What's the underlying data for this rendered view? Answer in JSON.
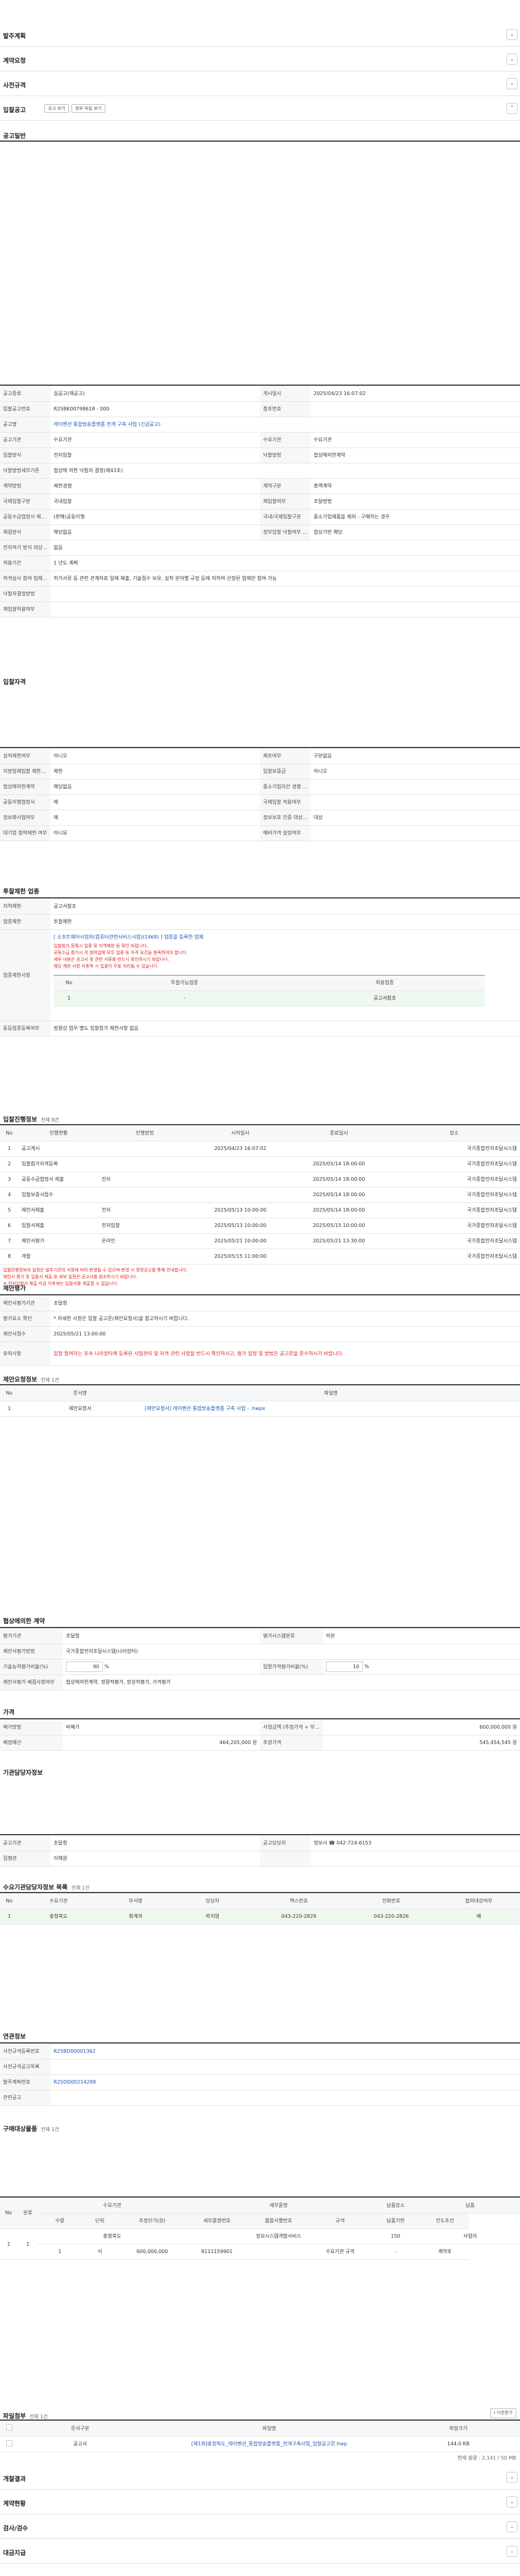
{
  "accordions": [
    "발주계획",
    "계약요청",
    "사전규격",
    "입찰공고"
  ],
  "notice_tab": {
    "label": "공고일반",
    "btn_a": "공고 보기",
    "btn_b": "첨부 파일 보기"
  },
  "general": {
    "rows": [
      [
        "공고종류",
        "실공고(재공고)",
        "게시일시",
        "2025/04/23 16:07:02"
      ],
      [
        "입찰공고번호",
        "R25BK00798618 - 000",
        "참조번호",
        ""
      ],
      [
        "공고명",
        "레이벤션 통합방송플랫폼 전개 구축 사업 (긴급공고)",
        "",
        ""
      ],
      [
        "공고기관",
        "수요기관",
        "수요기관",
        "수요기관"
      ],
      [
        "입찰방식",
        "전자입찰",
        "낙찰방법",
        "협상에의한계약"
      ],
      [
        "낙찰방법세부기준",
        "협상에 의한 낙찰자 결정(제43조)",
        "",
        ""
      ],
      [
        "계약방법",
        "제한경쟁",
        "계약구분",
        "총액계약"
      ],
      [
        "국제입찰구분",
        "국내입찰",
        "재입찰여부",
        "조달방법"
      ],
      [
        "공동수급협정서 제출 구성방식",
        "(판매)공동이행",
        "국내/국제입찰구분",
        "중소기업제품을 제외 - 구매하는 경우"
      ],
      [
        "채점방식",
        "해당없음",
        "정부입찰 낙찰여부 국제입찰 대상여부",
        "협상기반 해당"
      ],
      [
        "전자적기 방식 대상여부",
        "없음",
        "",
        ""
      ],
      [
        "적용기간",
        "1 년도 계획",
        "",
        ""
      ],
      [
        "적격심사 참여 업체 기준",
        "허가서류 등 관련 관계자료 일체 제출, 기술점수 보유, 실적 분야별 규정 등에 의하여 선정된 업체만 참여 가능",
        "",
        ""
      ],
      [
        "낙찰자결정방법",
        "",
        "",
        ""
      ],
      [
        "재입찰허용여부",
        "",
        "",
        ""
      ]
    ]
  },
  "qualification": {
    "title": "입찰자격",
    "rows": [
      [
        "실적제한여부",
        "아니오",
        "제조여부",
        "구분없음"
      ],
      [
        "지방업체입찰 제한여부",
        "제한",
        "입찰보증금",
        "아니오"
      ],
      [
        "협상에의한계약",
        "해당없음",
        "중소기업자간 경쟁 대상여부",
        ""
      ],
      [
        "공동이행협정서",
        "예",
        "국제입찰 적용여부",
        ""
      ],
      [
        "정보화사업여부",
        "예",
        "정보보호 인증 대상여부",
        "대상"
      ],
      [
        "대기업 참여제한 여부",
        "아니요",
        "예비가격 설정여부",
        ""
      ]
    ]
  },
  "region": {
    "title": "투찰제한 업종",
    "rows": [
      [
        "지역제한",
        "공고서참조"
      ],
      [
        "업종제한",
        "투찰제한"
      ]
    ],
    "bid_text": "[ 소프트웨어사업자(컴퓨터관련서비스사업)(1468) ] 업종을 등록한 업체",
    "notes": [
      "입찰참가 등록시 업종 및 지역제한 등 확인 바랍니다.",
      "공동수급 참가시 각 참여업체 모두 업종 등 자격 요건을 충족하여야 합니다.",
      "세부 내용은 공고서 및 관련 서류를 반드시 확인하시기 바랍니다.",
      "해당 제한 사항 미충족 시 입찰이 무효 처리될 수 있습니다."
    ],
    "sub_head": [
      "No",
      "투찰가능업종",
      "허용업종"
    ],
    "sub_row": [
      "1",
      "-",
      "공고서참조"
    ],
    "other": [
      "동등업종등록여부",
      "법령상 업무 별도 입찰참가 제한사항 없음"
    ]
  },
  "schedule": {
    "title": "입찰진행정보",
    "count": "전체 8건",
    "head": [
      "No",
      "진행현황",
      "진행방법",
      "시작일시",
      "종료일시",
      "장소"
    ],
    "rows": [
      [
        "1",
        "공고게시",
        "",
        "2025/04/23 16:07:02",
        "",
        "국가종합전자조달시스템"
      ],
      [
        "2",
        "입찰참가자격등록",
        "",
        "",
        "2025/05/14 18:00:00",
        "국가종합전자조달시스템"
      ],
      [
        "3",
        "공동수급협정서 제출",
        "전자",
        "",
        "2025/05/14 18:00:00",
        "국가종합전자조달시스템"
      ],
      [
        "4",
        "입찰보증서접수",
        "",
        "",
        "2025/05/14 18:00:00",
        "국가종합전자조달시스템"
      ],
      [
        "5",
        "제안서제출",
        "전자",
        "2025/05/13 10:00:00",
        "2025/05/14 18:00:00",
        "국가종합전자조달시스템"
      ],
      [
        "6",
        "입찰서제출",
        "전자입찰",
        "2025/05/13 10:00:00",
        "2025/05/15 10:00:00",
        "국가종합전자조달시스템"
      ],
      [
        "7",
        "제안서평가",
        "온라인",
        "2025/05/21 10:00:00",
        "2025/05/21 13:30:00",
        "국가종합전자조달시스템"
      ],
      [
        "8",
        "개찰",
        "",
        "2025/05/15 11:00:00",
        "",
        "국가종합전자조달시스템"
      ]
    ],
    "notes": [
      "입찰진행정보의 일정은 발주기관의 사정에 따라 변경될 수 있으며 변경 시 정정공고를 통해 안내합니다.",
      "제안서 평가 및 입찰서 제출 등 세부 일정은 공고서를 참조하시기 바랍니다.",
      "※ 전자입찰서 제출 마감 이후에는 입찰서를 제출할 수 없습니다."
    ]
  },
  "proposal": {
    "title": "제안평가",
    "rows": [
      [
        "제안서평가기관",
        "조달청"
      ],
      [
        "평가요소 확인",
        "* 자세한 사항은 입찰 공고문(제안요청서)을 참고하시기 바랍니다."
      ],
      [
        "제안서접수",
        "2025/05/21 13:00:00"
      ],
      [
        "유의사항",
        "입찰 참여자는 조속 나라장터에 등록된 사업관리 및 자격 관련 사항을 반드시 확인하시고, 평가 일정 및 방법은 공고문을 준수하시기 바랍니다."
      ]
    ]
  },
  "docs": {
    "title": "제안요청정보",
    "count": "전체 1건",
    "head": [
      "No",
      "문서명",
      "파일명"
    ],
    "row": [
      "1",
      "제안요청서",
      "[제안요청서] 레이벤션 통합방송플랫폼 구축 사업 - .hwpx"
    ]
  },
  "negotiation": {
    "title": "협상에의한 계약",
    "rows": [
      [
        "평가기관",
        "조달청",
        "평가시스템분류",
        "미분"
      ],
      [
        "제안서평가방법",
        "국가종합전자조달시스템(나라장터)",
        "",
        ""
      ],
      [
        "기술능력평가비율(%)",
        "90",
        "입찰가격평가비율(%)",
        "10"
      ],
      [
        "제안서평가 배점사항여부",
        "협상에의한계약, 정량적평가, 정성적평가, 가격평가",
        "",
        ""
      ]
    ],
    "unit": "%"
  },
  "price": {
    "title": "가격",
    "rows": [
      [
        "예가방법",
        "비예가",
        "사업금액 (추정가격 + 부가세)",
        "600,000,000 원"
      ],
      [
        "배정예산",
        "464,205,000 원",
        "추정가격",
        "545,454,545 원"
      ]
    ]
  },
  "agency": {
    "title": "기관담당자정보",
    "rows": [
      [
        "공고기관",
        "조달청",
        "공고담당자",
        "정보사 ☎ 042-724-6153"
      ],
      [
        "집행관",
        "이헤원",
        "",
        ""
      ]
    ]
  },
  "demand": {
    "title": "수요기관담당자정보 목록",
    "count": "전체 1건",
    "head": [
      "No",
      "수요기관",
      "부서명",
      "담당자",
      "핵스번호",
      "전화번호",
      "협의대상여부"
    ],
    "row": [
      "1",
      "충청북도",
      "회계과",
      "박지영",
      "043-220-2829",
      "043-220-2826",
      "예"
    ]
  },
  "relation": {
    "title": "연관정보",
    "rows": [
      [
        "사전규격등록번호",
        "R25BD00001362"
      ],
      [
        "사전규격공고목록",
        ""
      ],
      [
        "발주계획번호",
        "R25DD00214288"
      ],
      [
        "관련공고",
        ""
      ]
    ]
  },
  "purchase": {
    "title": "구매대상물품",
    "count": "전체 1건",
    "head1": [
      "No",
      "분류",
      "수요기관",
      "세부품명",
      "납품장소",
      "납품"
    ],
    "head2": [
      "수량",
      "단위",
      "추정단가(원)",
      "세부품명번호",
      "물품식별번호",
      "규격",
      "납품기한",
      "인도조건"
    ],
    "row1": [
      "1",
      "1",
      "충청북도",
      "정보시스템개발서비스",
      "150",
      "사업자"
    ],
    "row2": [
      "1",
      "식",
      "600,000,000",
      "8111159901",
      "",
      "수요기관 규격",
      "-",
      "계약후"
    ]
  },
  "attach": {
    "title": "파일첨부",
    "count": "전체 1건",
    "btn": "다운받기",
    "head": [
      "",
      "문서구분",
      "파일명",
      "파일크기"
    ],
    "row": [
      "",
      "공고서",
      "[제1회]충청북도_레이벤션_통합방송플랫폼_전개구축사업_입찰공고문.hwp",
      "144.0 KB"
    ],
    "total": "현재 용량 : 2,141 / 50 MB"
  },
  "bottom_accordions": [
    "개찰결과",
    "계약현황",
    "검사/검수",
    "대금지급"
  ]
}
